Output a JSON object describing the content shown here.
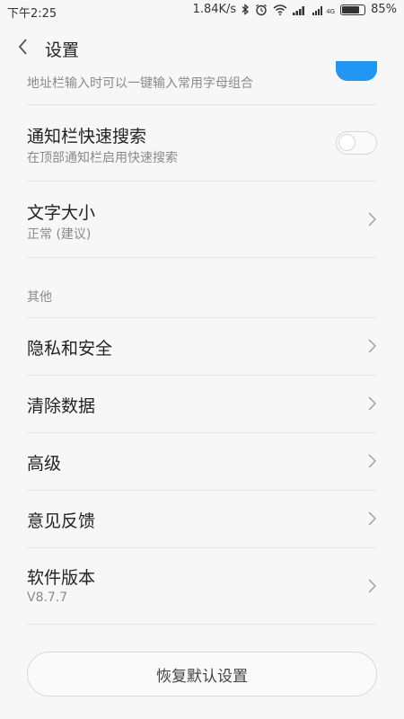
{
  "status_bar": {
    "time": "下午2:25",
    "net_speed": "1.84K/s",
    "battery_text": "85%",
    "battery_level": 0.85,
    "network_label": "4G",
    "icons": [
      "bluetooth-icon",
      "alarm-icon",
      "wifi-icon",
      "signal-icon",
      "signal-4g-icon",
      "battery-icon"
    ]
  },
  "header": {
    "back_icon": "chevron-left-icon",
    "title": "设置"
  },
  "settings": {
    "address_bar_item": {
      "subtitle": "地址栏输入时可以一键输入常用字母组合",
      "toggle_state": "on"
    },
    "notification_search": {
      "title": "通知栏快速搜索",
      "subtitle": "在顶部通知栏启用快速搜索",
      "toggle_state": "off"
    },
    "font_size": {
      "title": "文字大小",
      "subtitle": "正常 (建议)"
    },
    "section_other": "其他",
    "items": [
      {
        "label": "隐私和安全"
      },
      {
        "label": "清除数据"
      },
      {
        "label": "高级"
      },
      {
        "label": "意见反馈"
      }
    ],
    "version": {
      "title": "软件版本",
      "subtitle": "V8.7.7"
    }
  },
  "reset_button": "恢复默认设置",
  "colors": {
    "accent": "#2196f3",
    "background": "#f7f7f7"
  }
}
